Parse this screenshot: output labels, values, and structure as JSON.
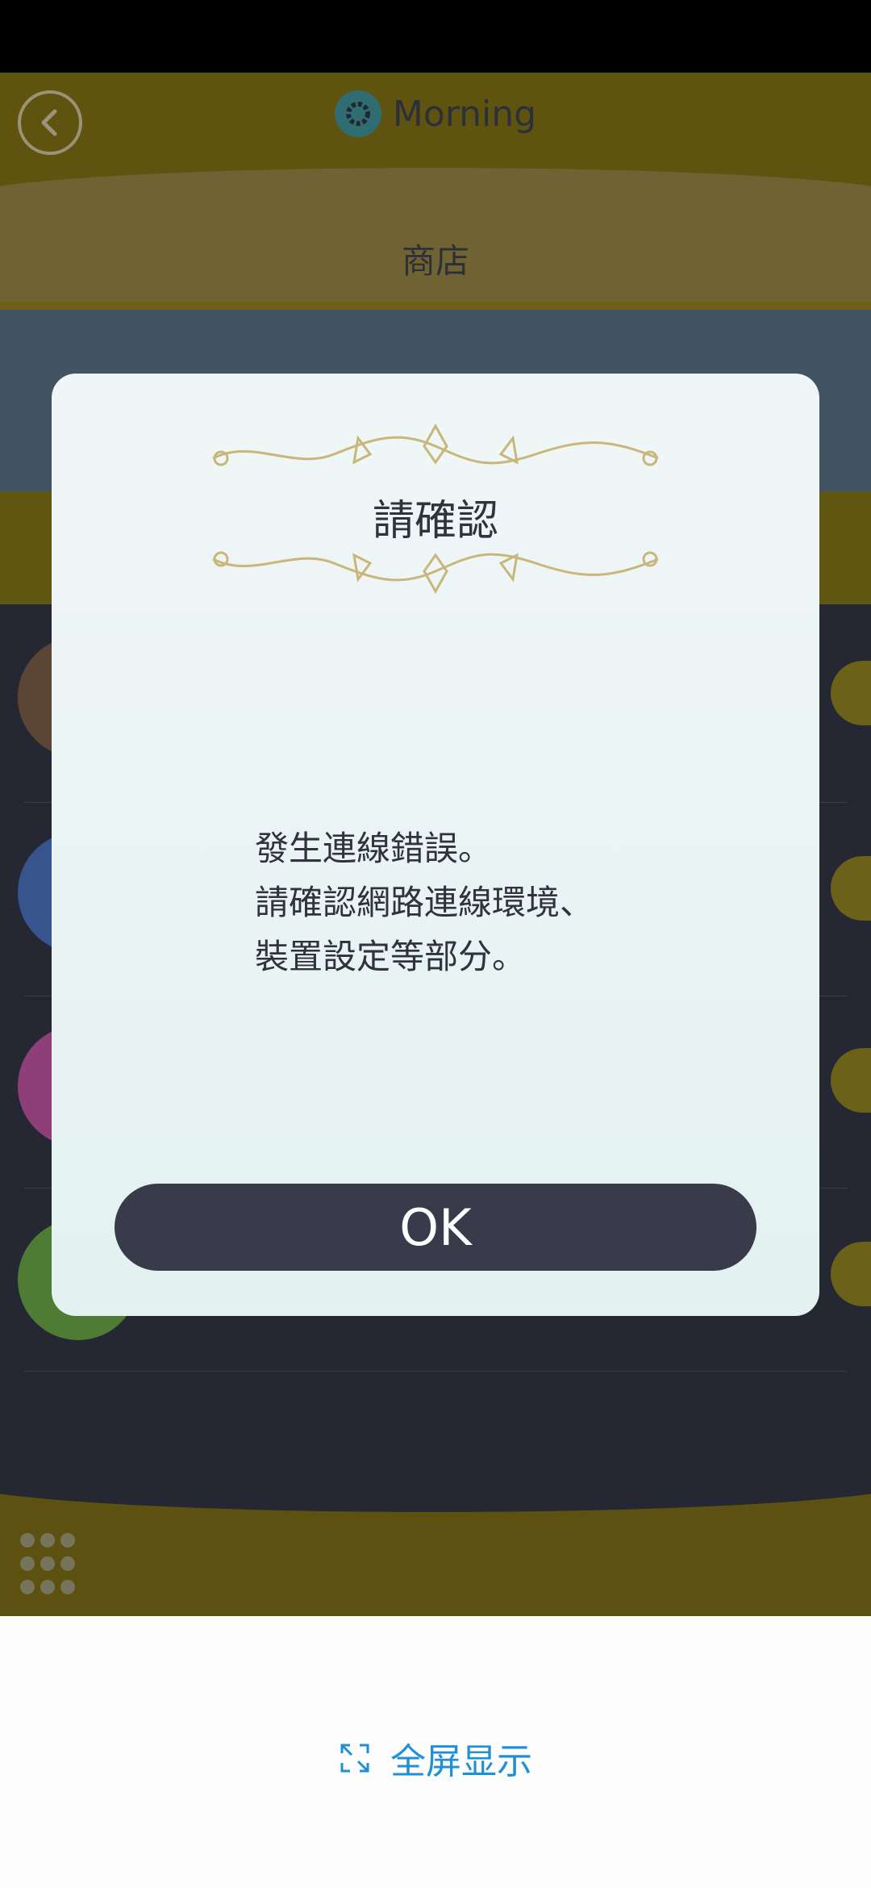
{
  "app": {
    "title": "Morning",
    "tab_label": "商店"
  },
  "dialog": {
    "title": "請確認",
    "message_lines": [
      "發生連線錯誤。",
      "請確認網路連線環境、",
      "裝置設定等部分。"
    ],
    "ok_label": "OK"
  },
  "bottom": {
    "fullscreen_label": "全屏显示"
  },
  "colors": {
    "header_yellow": "#5e5410",
    "dialog_bg": "#e8f3f3",
    "button_dark": "#393b4a",
    "link_blue": "#1f8fd6",
    "ornament_gold": "#c8b77a"
  },
  "icons": [
    "back-arrow-icon",
    "gear-icon",
    "grid-menu-icon",
    "fullscreen-icon"
  ]
}
